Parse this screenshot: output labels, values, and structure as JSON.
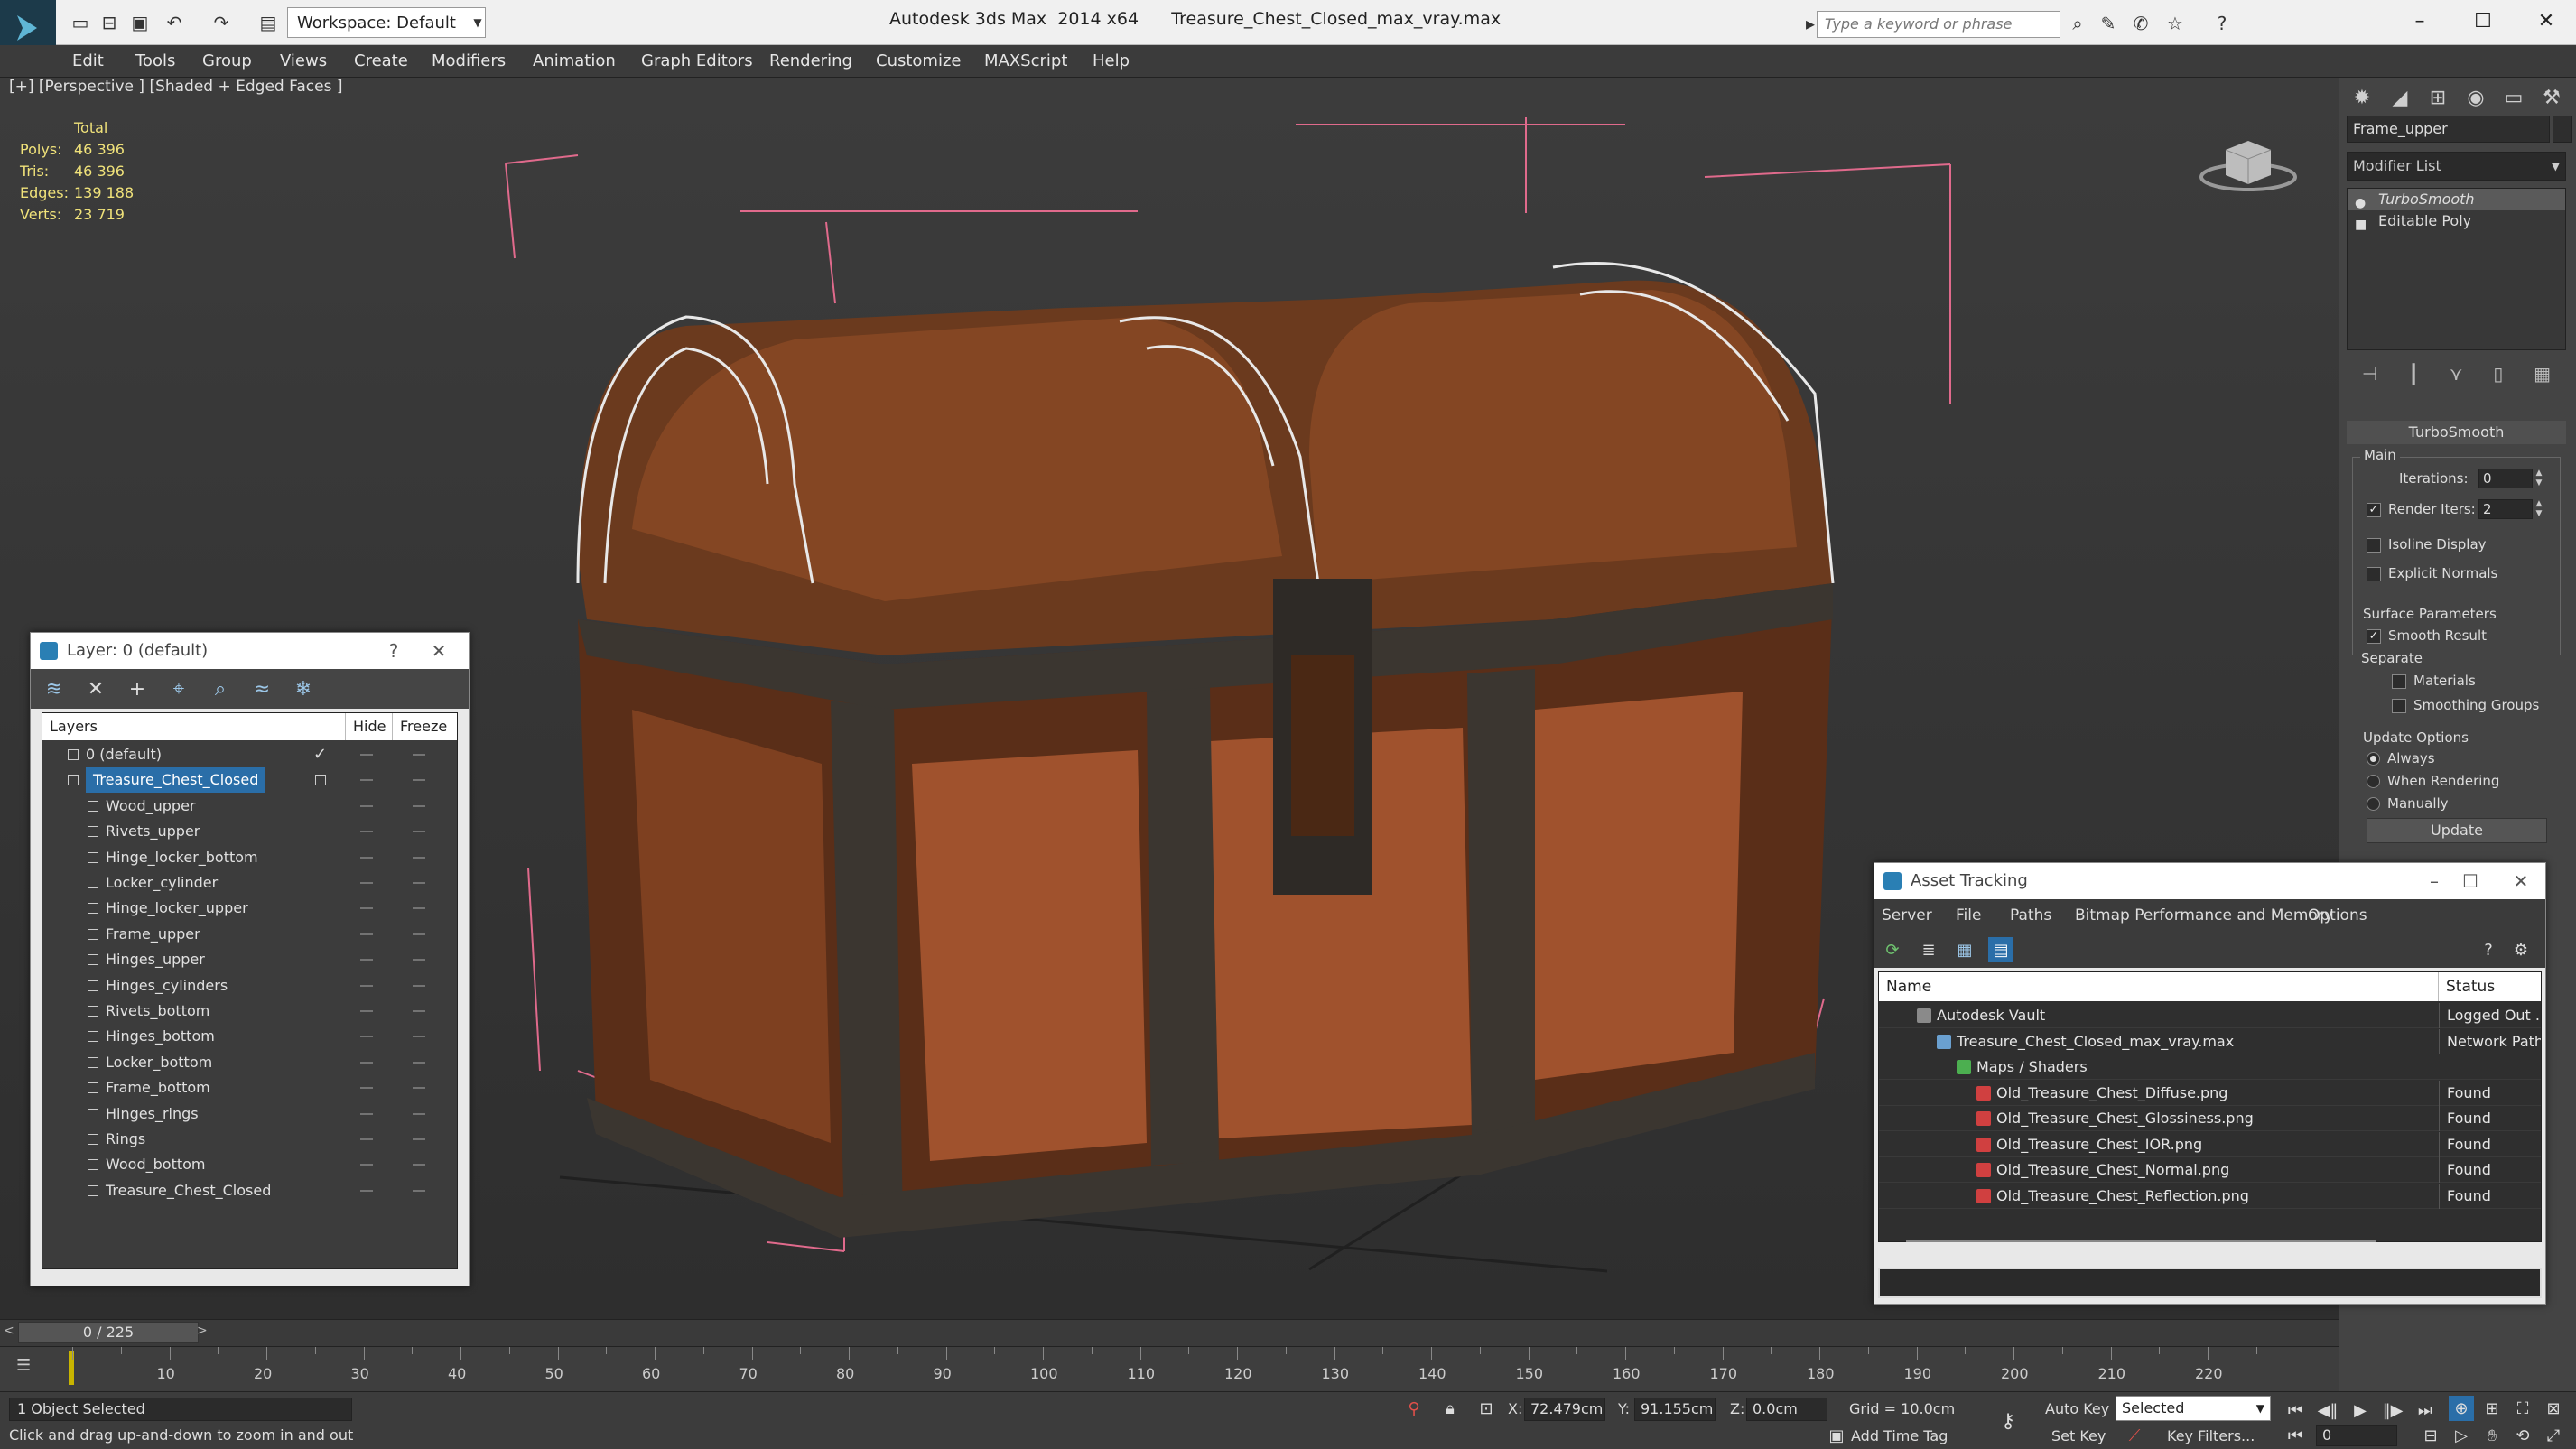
{
  "window": {
    "workspace": "Workspace: Default",
    "title": "Autodesk 3ds Max  2014 x64      Treasure_Chest_Closed_max_vray.max",
    "search_placeholder": "Type a keyword or phrase"
  },
  "menu": [
    "Edit",
    "Tools",
    "Group",
    "Views",
    "Create",
    "Modifiers",
    "Animation",
    "Graph Editors",
    "Rendering",
    "Customize",
    "MAXScript",
    "Help"
  ],
  "viewport": {
    "label": "[+] [Perspective ] [Shaded + Edged Faces ]",
    "stats": {
      "header": "Total",
      "rows": [
        {
          "label": "Polys:",
          "value": "46 396"
        },
        {
          "label": "Tris:",
          "value": "46 396"
        },
        {
          "label": "Edges:",
          "value": "139 188"
        },
        {
          "label": "Verts:",
          "value": "23 719"
        }
      ]
    }
  },
  "command_panel": {
    "object_name": "Frame_upper",
    "modifier_list": "Modifier List",
    "stack": [
      "TurboSmooth",
      "Editable Poly"
    ],
    "rollout_title": "TurboSmooth",
    "main_group": "Main",
    "iterations_label": "Iterations:",
    "iterations_value": "0",
    "render_iters_label": "Render Iters:",
    "render_iters_value": "2",
    "isoline": "Isoline Display",
    "explicit_normals": "Explicit Normals",
    "surface_group": "Surface Parameters",
    "smooth_result": "Smooth Result",
    "separate": "Separate",
    "materials": "Materials",
    "smoothing_groups": "Smoothing Groups",
    "update_group": "Update Options",
    "always": "Always",
    "when_rendering": "When Rendering",
    "manually": "Manually",
    "update_button": "Update"
  },
  "layer_dialog": {
    "title": "Layer: 0 (default)",
    "help": "?",
    "col_layers": "Layers",
    "col_hide": "Hide",
    "col_freeze": "Freeze",
    "rows": [
      {
        "name": "0 (default)",
        "level": 0,
        "checked": true
      },
      {
        "name": "Treasure_Chest_Closed",
        "level": 0,
        "selected": true
      },
      {
        "name": "Wood_upper",
        "level": 1
      },
      {
        "name": "Rivets_upper",
        "level": 1
      },
      {
        "name": "Hinge_locker_bottom",
        "level": 1
      },
      {
        "name": "Locker_cylinder",
        "level": 1
      },
      {
        "name": "Hinge_locker_upper",
        "level": 1
      },
      {
        "name": "Frame_upper",
        "level": 1
      },
      {
        "name": "Hinges_upper",
        "level": 1
      },
      {
        "name": "Hinges_cylinders",
        "level": 1
      },
      {
        "name": "Rivets_bottom",
        "level": 1
      },
      {
        "name": "Hinges_bottom",
        "level": 1
      },
      {
        "name": "Locker_bottom",
        "level": 1
      },
      {
        "name": "Frame_bottom",
        "level": 1
      },
      {
        "name": "Hinges_rings",
        "level": 1
      },
      {
        "name": "Rings",
        "level": 1
      },
      {
        "name": "Wood_bottom",
        "level": 1
      },
      {
        "name": "Treasure_Chest_Closed",
        "level": 1
      }
    ]
  },
  "asset_dialog": {
    "title": "Asset Tracking",
    "menu": [
      "Server",
      "File",
      "Paths",
      "Bitmap Performance and Memory",
      "Options"
    ],
    "col_name": "Name",
    "col_status": "Status",
    "rows": [
      {
        "name": "Autodesk Vault",
        "status": "Logged Out ..",
        "level": 1,
        "icon": "#8a8a8a"
      },
      {
        "name": "Treasure_Chest_Closed_max_vray.max",
        "status": "Network Path",
        "level": 2,
        "icon": "#6aa0d0"
      },
      {
        "name": "Maps / Shaders",
        "status": "",
        "level": 3,
        "icon": "#4caf50"
      },
      {
        "name": "Old_Treasure_Chest_Diffuse.png",
        "status": "Found",
        "level": 4,
        "icon": "#d04040"
      },
      {
        "name": "Old_Treasure_Chest_Glossiness.png",
        "status": "Found",
        "level": 4,
        "icon": "#d04040"
      },
      {
        "name": "Old_Treasure_Chest_IOR.png",
        "status": "Found",
        "level": 4,
        "icon": "#d04040"
      },
      {
        "name": "Old_Treasure_Chest_Normal.png",
        "status": "Found",
        "level": 4,
        "icon": "#d04040"
      },
      {
        "name": "Old_Treasure_Chest_Reflection.png",
        "status": "Found",
        "level": 4,
        "icon": "#d04040"
      }
    ]
  },
  "timeline": {
    "frame_range": "0 / 225",
    "ticks": [
      "10",
      "20",
      "30",
      "40",
      "50",
      "60",
      "70",
      "80",
      "90",
      "100",
      "110",
      "120",
      "130",
      "140",
      "150",
      "160",
      "170",
      "180",
      "190",
      "200",
      "210",
      "220"
    ]
  },
  "status": {
    "selection": "1 Object Selected",
    "prompt": "Click and drag up-and-down to zoom in and out",
    "x_label": "X:",
    "x_value": "72.479cm",
    "y_label": "Y:",
    "y_value": "91.155cm",
    "z_label": "Z:",
    "z_value": "0.0cm",
    "grid": "Grid = 10.0cm",
    "auto_key": "Auto Key",
    "selected_dropdown": "Selected",
    "set_key": "Set Key",
    "key_filters": "Key Filters...",
    "add_time_tag": "Add Time Tag",
    "frame": "0"
  }
}
